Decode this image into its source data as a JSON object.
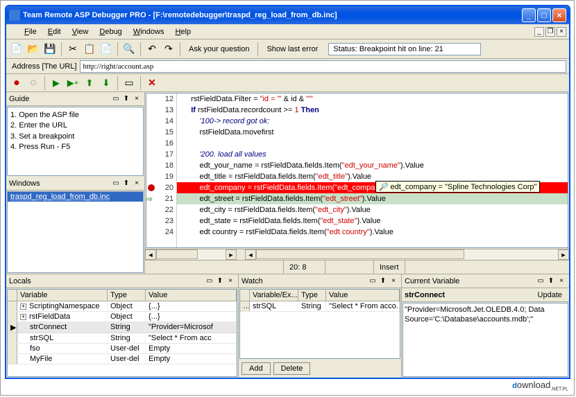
{
  "title": "Team Remote ASP Debugger PRO - [F:\\remotedebugger\\traspd_reg_load_from_db.inc]",
  "menu": {
    "file": "File",
    "edit": "Edit",
    "view": "View",
    "debug": "Debug",
    "windows": "Windows",
    "help": "Help"
  },
  "toolbar": {
    "ask": "Ask your question",
    "showlast": "Show last error",
    "status": "Status: Breakpoint hit on line: 21"
  },
  "address": {
    "label": "Address [The URL]",
    "value": "http://right/account.asp"
  },
  "guide": {
    "title": "Guide",
    "items": [
      "1. Open the ASP file",
      "2. Enter the URL",
      "3. Set a breakpoint",
      "4. Press Run - F5"
    ]
  },
  "windows": {
    "title": "Windows",
    "items": [
      "traspd_reg_load_from_db.inc"
    ]
  },
  "code": {
    "lines": [
      {
        "n": 12,
        "html": "    rstFieldData.Filter = <span class='str'>\"id = '\"</span> & id & <span class='str'>\"'\"</span>"
      },
      {
        "n": 13,
        "html": "    <span class='kw'>If</span> rstFieldData.recordcount >= <span class='num'>1</span> <span class='kw'>Then</span>"
      },
      {
        "n": 14,
        "html": "        <span class='cm'>'100-&gt; record got ok:</span>"
      },
      {
        "n": 15,
        "html": "        rstFieldData.movefirst"
      },
      {
        "n": 16,
        "html": ""
      },
      {
        "n": 17,
        "html": "        <span class='cm'>'200. load all values</span>"
      },
      {
        "n": 18,
        "html": "        edt_your_name = rstFieldData.fields.Item(<span class='str'>\"edt_your_name\"</span>).Value"
      },
      {
        "n": 19,
        "html": "        edt_title = rstFieldData.fields.Item(<span class='str'>\"edt_title\"</span>).Value"
      },
      {
        "n": 20,
        "html": "        edt_company = rstFieldData.fields.Item(\"edt_company\").Value",
        "bp": true
      },
      {
        "n": 21,
        "html": "        edt_street = rstFieldData.fields.Item(<span class='str'>\"edt_street\"</span>).Value",
        "cur": true
      },
      {
        "n": 22,
        "html": "        edt_city = rstFieldData.fields.Item(<span class='str'>\"edt_city\"</span>).Value"
      },
      {
        "n": 23,
        "html": "        edt_state = rstFieldData.fields.Item(<span class='str'>\"edt_state\"</span>).Value"
      },
      {
        "n": 24,
        "html": "        edt country = rstFieldData.fields.Item(<span class='str'>\"edt country\"</span>).Value"
      }
    ],
    "tooltip": "edt_company = \"Spline Technologies Corp\""
  },
  "status": {
    "pos": "20: 8",
    "mode": "Insert"
  },
  "locals": {
    "title": "Locals",
    "cols": [
      "Variable",
      "Type",
      "Value"
    ],
    "rows": [
      {
        "exp": "+",
        "name": "ScriptingNamespace",
        "type": "Object",
        "value": "{...}"
      },
      {
        "exp": "+",
        "name": "rstFieldData",
        "type": "Object",
        "value": "{...}"
      },
      {
        "ind": "▶",
        "name": "strConnect",
        "type": "String",
        "value": "\"Provider=Microsof"
      },
      {
        "name": "strSQL",
        "type": "String",
        "value": "\"Select * From acc"
      },
      {
        "name": "fso",
        "type": "User-del",
        "value": "Empty"
      },
      {
        "name": "MyFile",
        "type": "User-del",
        "value": "Empty"
      }
    ]
  },
  "watch": {
    "title": "Watch",
    "cols": [
      "Variable/Ex...",
      "Type",
      "Value"
    ],
    "rows": [
      {
        "name": "strSQL",
        "type": "String",
        "value": "\"Select * From acco..."
      }
    ],
    "btnAdd": "Add",
    "btnDelete": "Delete"
  },
  "curvar": {
    "title": "Current Variable",
    "name": "strConnect",
    "update": "Update",
    "value": "\"Provider=Microsoft.Jet.OLEDB.4.0; Data Source='C:\\Database\\accounts.mdb';\""
  },
  "watermark": "download"
}
